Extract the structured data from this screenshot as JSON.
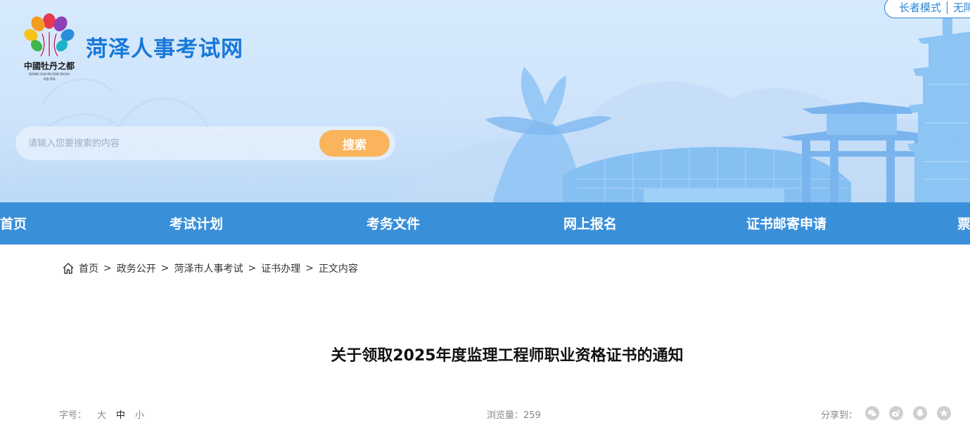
{
  "header": {
    "site_title": "菏泽人事考试网",
    "logo_text": "中國牡丹之都",
    "logo_subtext": "ZHONG GUO MU DAN ZHI DU",
    "logo_caption": "中国·菏泽",
    "mode_switch": {
      "elder_mode": "长者模式",
      "accessibility": "无障碍"
    },
    "search": {
      "placeholder": "请输入您要搜索的内容",
      "button_label": "搜索"
    }
  },
  "nav": {
    "items": [
      {
        "label": "网站首页"
      },
      {
        "label": "考试计划"
      },
      {
        "label": "考务文件"
      },
      {
        "label": "网上报名"
      },
      {
        "label": "证书邮寄申请"
      },
      {
        "label": "票"
      }
    ]
  },
  "breadcrumb": {
    "items": [
      "首页",
      "政务公开",
      "菏泽市人事考试",
      "证书办理",
      "正文内容"
    ],
    "separator": ">"
  },
  "article": {
    "title": "关于领取2025年度监理工程师职业资格证书的通知",
    "font_size_label": "字号：",
    "font_sizes": [
      "大",
      "中",
      "小"
    ],
    "active_font_size": "中",
    "views_label": "浏览量：",
    "views_count": "259",
    "share_label": "分享到：",
    "share_icons": [
      "wechat-icon",
      "weibo-icon",
      "qq-icon",
      "qzone-icon"
    ]
  },
  "colors": {
    "brand_blue": "#1677d8",
    "nav_bg": "#3a8fd9",
    "search_button": "#f9b45c",
    "banner_bg": "#d6eafc"
  }
}
